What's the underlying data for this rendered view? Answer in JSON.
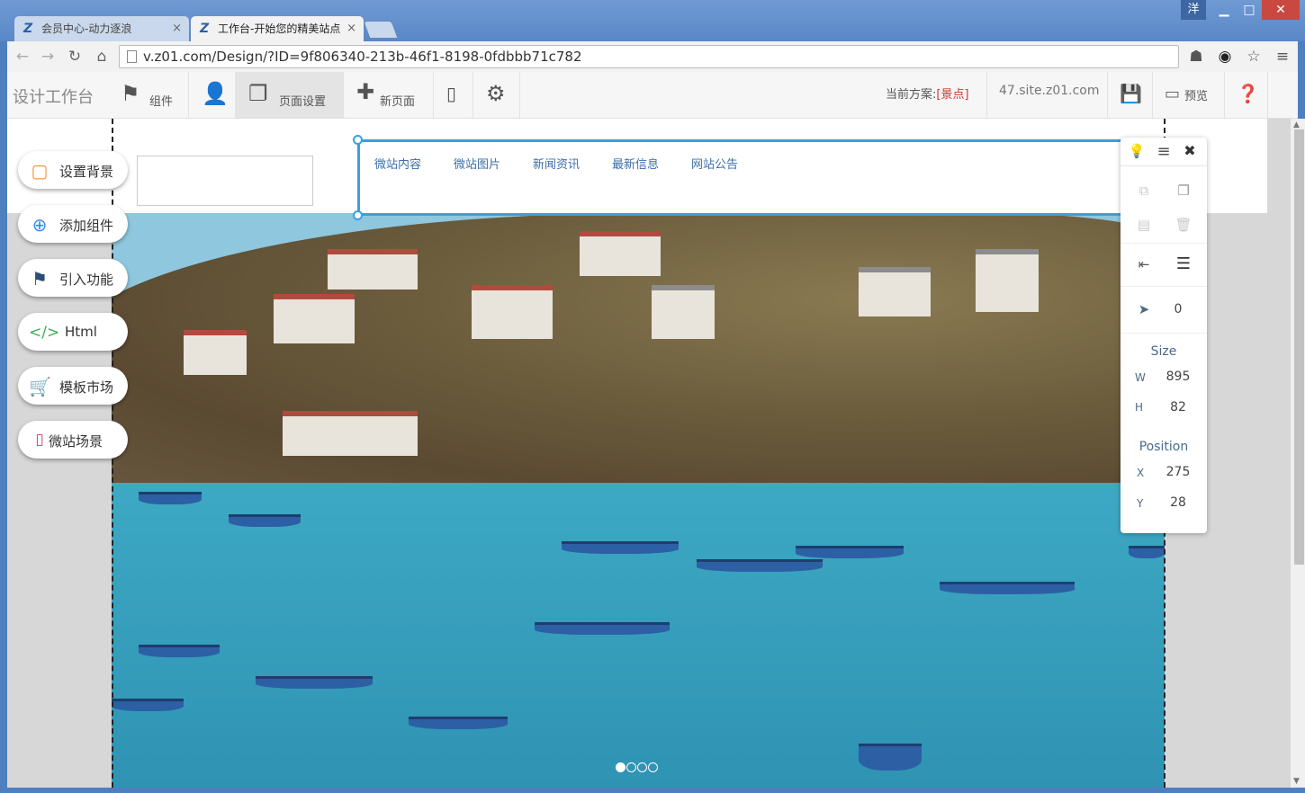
{
  "browser": {
    "tabs": [
      {
        "title": "会员中心-动力逐浪",
        "close": "×"
      },
      {
        "title": "工作台-开始您的精美站点",
        "close": "×"
      }
    ],
    "user_badge": "洋",
    "url": "v.z01.com/Design/?ID=9f806340-213b-46f1-8198-0fdbbb71c782",
    "window_controls": {
      "minimize": "▁",
      "maximize": "□",
      "close": "✕"
    }
  },
  "appbar": {
    "brand": "设计工作台",
    "items": [
      {
        "label": "组件",
        "icon": "flag-icon"
      },
      {
        "label": "",
        "icon": "user-icon"
      },
      {
        "label": "页面设置",
        "icon": "page-settings-icon"
      },
      {
        "label": "新页面",
        "icon": "plus-icon"
      },
      {
        "label": "",
        "icon": "mobile-icon"
      },
      {
        "label": "",
        "icon": "gear-icon"
      }
    ],
    "plan_prefix": "当前方案:",
    "plan_name": "[景点]",
    "domain": "47.site.z01.com",
    "preview_label": "预览"
  },
  "sidebar": {
    "buttons": [
      {
        "label": "设置背景",
        "icon": "square-icon",
        "color": "#f0913a"
      },
      {
        "label": "添加组件",
        "icon": "plus-circle-icon",
        "color": "#3a8ee0"
      },
      {
        "label": "引入功能",
        "icon": "flag-icon",
        "color": "#2c4d7a"
      },
      {
        "label": "Html",
        "icon": "code-icon",
        "color": "#3cae54"
      },
      {
        "label": "模板市场",
        "icon": "cart-icon",
        "color": "#d63a73"
      },
      {
        "label": "微站场景",
        "icon": "mobile-icon",
        "color": "#d63a73"
      }
    ]
  },
  "nav_menu": {
    "items": [
      "微站内容",
      "微站图片",
      "新闻资讯",
      "最新信息",
      "网站公告"
    ]
  },
  "slider": {
    "dots": 4,
    "active": 0
  },
  "panel": {
    "z_index": "0",
    "size_title": "Size",
    "w_label": "W",
    "w_value": "895",
    "h_label": "H",
    "h_value": "82",
    "position_title": "Position",
    "x_label": "X",
    "x_value": "275",
    "y_label": "Y",
    "y_value": "28"
  }
}
